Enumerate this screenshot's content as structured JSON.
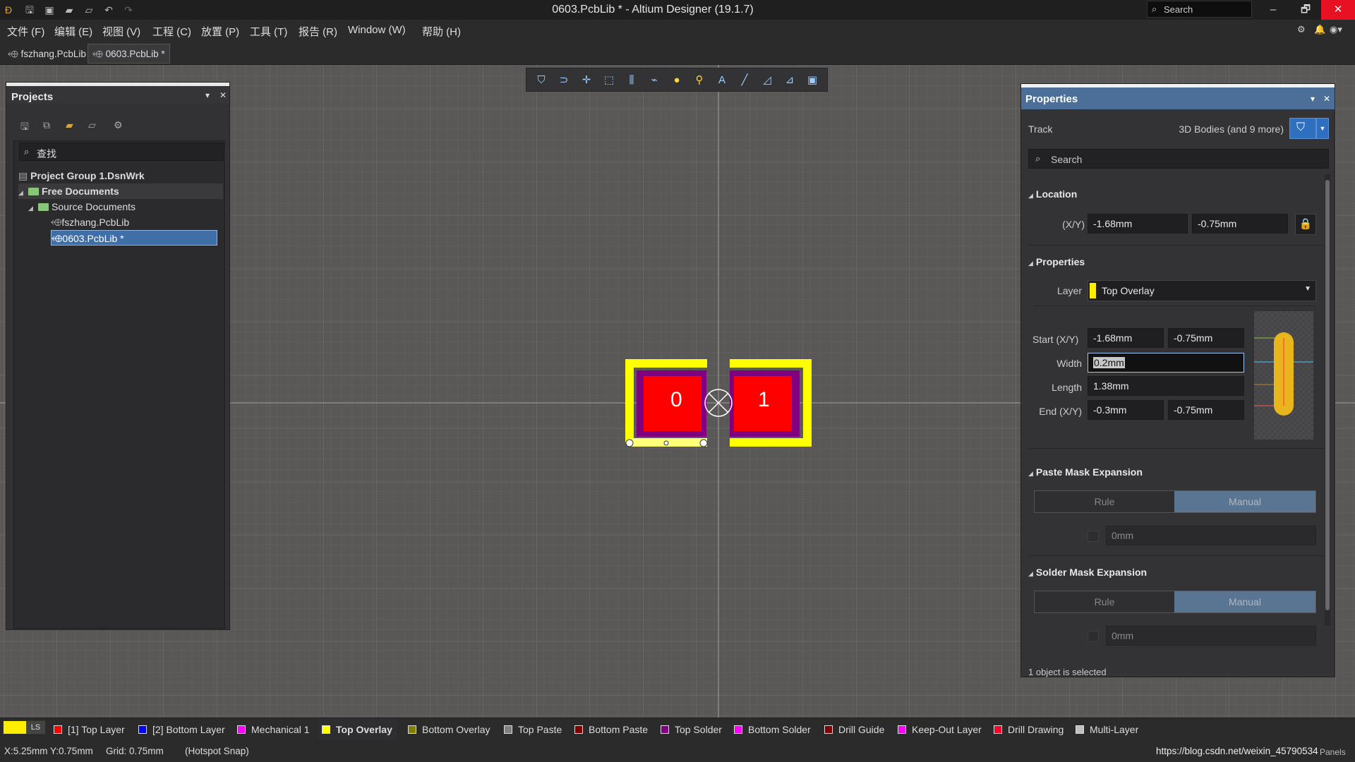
{
  "app": {
    "title": "0603.PcbLib * - Altium Designer (19.1.7)",
    "search_placeholder": "Search",
    "minimize": "–",
    "restore": "🗗",
    "close": "✕"
  },
  "menu": [
    "文件 (F)",
    "编辑 (E)",
    "视图 (V)",
    "工程 (C)",
    "放置 (P)",
    "工具 (T)",
    "报告 (R)",
    "Window (W)",
    "帮助 (H)"
  ],
  "tabs": [
    {
      "label": "fszhang.PcbLib",
      "active": false
    },
    {
      "label": "0603.PcbLib *",
      "active": true
    }
  ],
  "projects": {
    "title": "Projects",
    "search_placeholder": "查找",
    "tree": [
      {
        "label": "Project Group 1.DsnWrk",
        "level": 0,
        "bold": true
      },
      {
        "label": "Free Documents",
        "level": 1,
        "bold": true
      },
      {
        "label": "Source Documents",
        "level": 2
      },
      {
        "label": "fszhang.PcbLib",
        "level": 3
      },
      {
        "label": "0603.PcbLib *",
        "level": 3,
        "selected": true
      }
    ]
  },
  "pads": [
    {
      "label": "0"
    },
    {
      "label": "1"
    }
  ],
  "properties": {
    "title": "Properties",
    "object_type": "Track",
    "filter_summary": "3D Bodies (and 9 more)",
    "search_placeholder": "Search",
    "location": {
      "section": "Location",
      "label": "(X/Y)",
      "x": "-1.68mm",
      "y": "-0.75mm"
    },
    "props": {
      "section": "Properties",
      "layer_label": "Layer",
      "layer": "Top Overlay",
      "layer_color": "#ffee00",
      "start_label": "Start (X/Y)",
      "start_x": "-1.68mm",
      "start_y": "-0.75mm",
      "width_label": "Width",
      "width": "0.2mm",
      "length_label": "Length",
      "length": "1.38mm",
      "end_label": "End (X/Y)",
      "end_x": "-0.3mm",
      "end_y": "-0.75mm"
    },
    "paste": {
      "section": "Paste Mask Expansion",
      "rule": "Rule",
      "manual": "Manual",
      "value": "0mm"
    },
    "solder": {
      "section": "Solder Mask Expansion",
      "rule": "Rule",
      "manual": "Manual",
      "value": "0mm"
    },
    "status": "1 object is selected"
  },
  "layers": [
    {
      "label": "[1] Top Layer",
      "color": "#ff0000"
    },
    {
      "label": "[2] Bottom Layer",
      "color": "#0000ff"
    },
    {
      "label": "Mechanical 1",
      "color": "#ff00ff"
    },
    {
      "label": "Top Overlay",
      "color": "#ffff00",
      "active": true
    },
    {
      "label": "Bottom Overlay",
      "color": "#808000"
    },
    {
      "label": "Top Paste",
      "color": "#808080"
    },
    {
      "label": "Bottom Paste",
      "color": "#800000"
    },
    {
      "label": "Top Solder",
      "color": "#800080"
    },
    {
      "label": "Bottom Solder",
      "color": "#ff00ff"
    },
    {
      "label": "Drill Guide",
      "color": "#800000"
    },
    {
      "label": "Keep-Out Layer",
      "color": "#ff00ff"
    },
    {
      "label": "Drill Drawing",
      "color": "#ff002a"
    },
    {
      "label": "Multi-Layer",
      "color": "#c0c0c0"
    }
  ],
  "ls_label": "LS",
  "status": {
    "coords": "X:5.25mm Y:0.75mm",
    "grid": "Grid: 0.75mm",
    "snap": "(Hotspot Snap)",
    "watermark": "https://blog.csdn.net/weixin_45790534",
    "panels": "Panels"
  }
}
